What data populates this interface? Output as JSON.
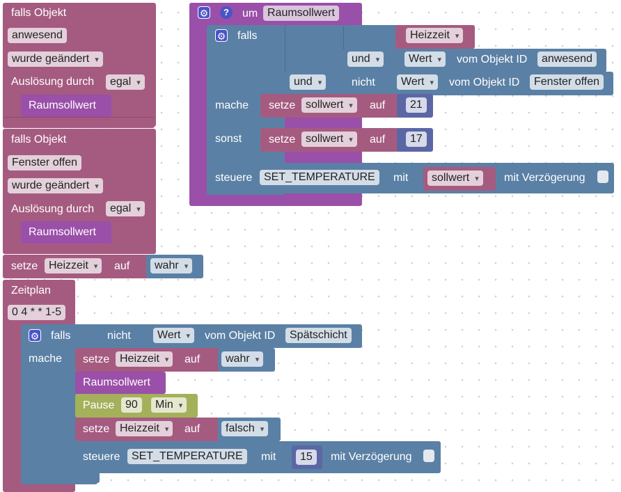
{
  "trigger1": {
    "title": "falls Objekt",
    "object": "anwesend",
    "event": "wurde geändert",
    "trigger_label": "Auslösung durch",
    "trigger_value": "egal",
    "call": "Raumsollwert"
  },
  "trigger2": {
    "title": "falls Objekt",
    "object": "Fenster offen",
    "event": "wurde geändert",
    "trigger_label": "Auslösung durch",
    "trigger_value": "egal",
    "call": "Raumsollwert"
  },
  "setvar1": {
    "setze": "setze",
    "var": "Heizzeit",
    "auf": "auf",
    "value": "wahr"
  },
  "schedule": {
    "title": "Zeitplan",
    "cron": "0 4 * * 1-5",
    "if_label": "falls",
    "nicht": "nicht",
    "wert": "Wert",
    "vom_objekt": "vom Objekt ID",
    "object": "Spätschicht",
    "mache": "mache",
    "set1": {
      "setze": "setze",
      "var": "Heizzeit",
      "auf": "auf",
      "value": "wahr"
    },
    "call": "Raumsollwert",
    "pause": {
      "label": "Pause",
      "value": "90",
      "unit": "Min"
    },
    "set2": {
      "setze": "setze",
      "var": "Heizzeit",
      "auf": "auf",
      "value": "falsch"
    },
    "steuere": {
      "label": "steuere",
      "value": "SET_TEMPERATURE",
      "mit": "mit",
      "number": "15",
      "delay": "mit Verzögerung"
    }
  },
  "function": {
    "um": "um",
    "name": "Raumsollwert",
    "falls": "falls",
    "heizzeit": "Heizzeit",
    "und": "und",
    "wert": "Wert",
    "vom_objekt": "vom Objekt ID",
    "obj1": "anwesend",
    "nicht": "nicht",
    "obj2": "Fenster offen",
    "mache": "mache",
    "sonst": "sonst",
    "set1": {
      "setze": "setze",
      "var": "sollwert",
      "auf": "auf",
      "value": "21"
    },
    "set2": {
      "setze": "setze",
      "var": "sollwert",
      "auf": "auf",
      "value": "17"
    },
    "steuere": {
      "label": "steuere",
      "value": "SET_TEMPERATURE",
      "mit": "mit",
      "var": "sollwert",
      "delay": "mit Verzögerung"
    }
  },
  "icons": [
    "gear-icon",
    "help-icon",
    "dropdown-arrow-icon"
  ],
  "colors": {
    "trigger": "#a55b80",
    "function": "#9a4fa8",
    "logic": "#5b80a5",
    "math": "#5b67a5",
    "pause": "#a5b05b"
  }
}
